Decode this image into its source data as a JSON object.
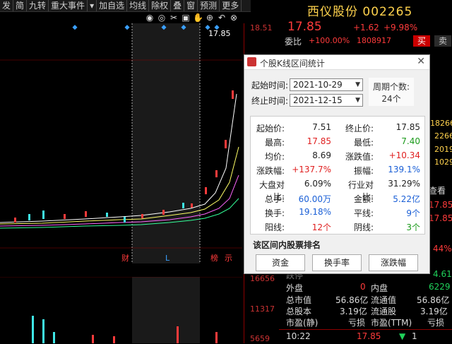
{
  "toolbar": {
    "items": [
      "发",
      "简",
      "九转",
      "重大事件",
      "▾",
      "加自选",
      "均线",
      "除权",
      "叠",
      "窗",
      "预测",
      "更多"
    ],
    "chevron": "▾"
  },
  "chart_icons": [
    "eye-icon",
    "eye-off-icon",
    "scissors-icon",
    "lock-icon",
    "hand-icon",
    "add-icon",
    "undo-icon",
    "close-icon"
  ],
  "chart": {
    "price_label": "17.85",
    "y_labels": [
      "18.51"
    ],
    "x_markers": {
      "fin": "财",
      "l": "L",
      "bang": "榜",
      "lian": "示"
    },
    "volume_labels": [
      "16656",
      "11317",
      "5659"
    ]
  },
  "quote": {
    "name": "西仪股份",
    "code": "002265",
    "price": "17.85",
    "change": "+1.62",
    "pct": "+9.98%",
    "weibi_label": "委比",
    "weibi_value": "+100.00%",
    "weibi_count": "1808917",
    "buy": "买",
    "sell": "卖",
    "right_vals": [
      "18266",
      "2266",
      "2019",
      "1029",
      "查看",
      "17.85",
      "17.85",
      "44%",
      "4.61",
      "6229"
    ],
    "rows": [
      {
        "k1": "外盘",
        "v1": "0",
        "k2": "内盘",
        "v2": ""
      },
      {
        "k1": "总市值",
        "v1": "56.86亿",
        "k2": "流通值",
        "v2": "56.86亿"
      },
      {
        "k1": "总股本",
        "v1": "3.19亿",
        "k2": "流通股",
        "v2": "3.19亿"
      },
      {
        "k1": "市盈(静)",
        "v1": "亏损",
        "k2": "市盈(TTM)",
        "v2": "亏损"
      }
    ],
    "time": "10:22",
    "time_price": "17.85",
    "time_vol": "1",
    "fade_row": "跌停"
  },
  "dialog": {
    "title": "个股K线区间统计",
    "start_label": "起始时间:",
    "start_value": "2021-10-29",
    "end_label": "终止时间:",
    "end_value": "2021-12-15",
    "period_label": "周期个数:",
    "period_value": "24个",
    "stats": [
      {
        "k": "起始价:",
        "v": "7.51",
        "k2": "终止价:",
        "v2": "17.85"
      },
      {
        "k": "最高:",
        "v": "17.85",
        "k2": "最低:",
        "v2": "7.40"
      },
      {
        "k": "均价:",
        "v": "8.69",
        "k2": "涨跌值:",
        "v2": "+10.34"
      },
      {
        "k": "涨跌幅:",
        "v": "+137.7%",
        "k2": "振幅:",
        "v2": "139.1%"
      },
      {
        "k": "大盘对比:",
        "v": "6.09%",
        "k2": "行业对比:",
        "v2": "31.29%"
      },
      {
        "k": "总手:",
        "v": "60.00万",
        "k2": "金额:",
        "v2": "5.22亿"
      },
      {
        "k": "换手:",
        "v": "19.18%",
        "k2": "平线:",
        "v2": "9个"
      },
      {
        "k": "阳线:",
        "v": "12个",
        "k2": "阴线:",
        "v2": "3个"
      }
    ],
    "rank_label": "该区间内股票排名",
    "buttons": [
      "资金",
      "换手率",
      "涨跌幅"
    ]
  }
}
